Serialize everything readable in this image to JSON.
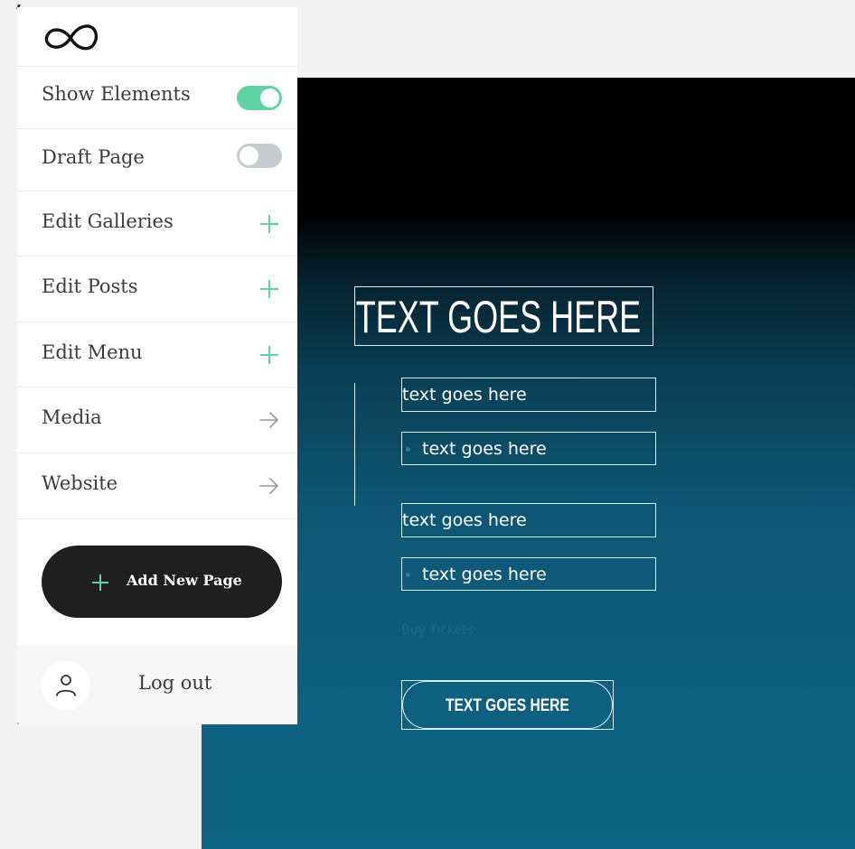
{
  "canvas": {
    "hero_title": "TEXT GOES HERE",
    "text_boxes": [
      "text goes here",
      "text goes here",
      "text goes here",
      "text goes here"
    ],
    "faint_text": "Buy Tickets",
    "cta_label": "TEXT GOES HERE"
  },
  "sidebar": {
    "logo_icon": "infinity-logo",
    "items": [
      {
        "label": "Show Elements",
        "control": "toggle",
        "state": "on"
      },
      {
        "label": "Draft Page",
        "control": "toggle",
        "state": "off"
      },
      {
        "label": "Edit Galleries",
        "control": "plus-icon"
      },
      {
        "label": "Edit Posts",
        "control": "plus-icon"
      },
      {
        "label": "Edit Menu",
        "control": "plus-icon"
      },
      {
        "label": "Media",
        "control": "arrow-right-icon"
      },
      {
        "label": "Website",
        "control": "arrow-right-icon"
      }
    ],
    "add_page_label": "Add New Page",
    "logout_label": "Log out"
  },
  "colors": {
    "accent": "#5fd3a1",
    "button_dark": "#1f1f1f",
    "canvas_top": "#000000",
    "canvas_bottom": "#0f6585",
    "toggle_off": "#c6cbd0"
  }
}
